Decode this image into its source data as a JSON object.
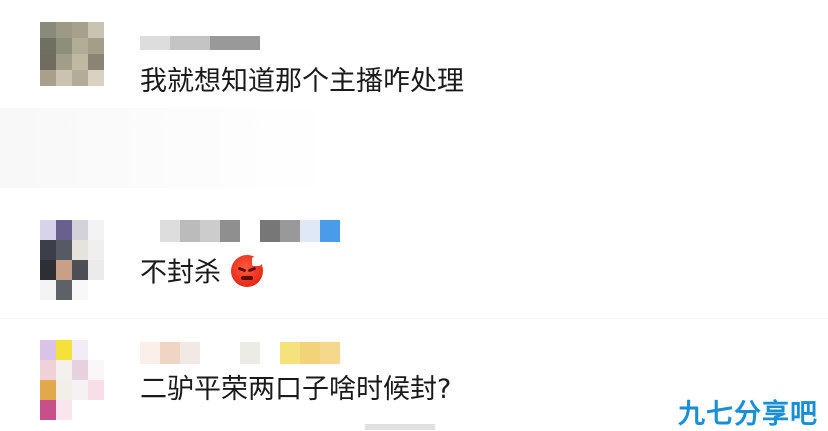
{
  "comments": [
    {
      "text": "我就想知道那个主播咋处理"
    },
    {
      "text": "不封杀",
      "emoji": "angry-face-emoji"
    },
    {
      "text": "二驴平荣两口子啥时候封?"
    }
  ],
  "watermark": "九七分享吧",
  "colors": {
    "text": "#1a1a1a",
    "watermark": "#1a8fd6",
    "emoji": "#e8291b"
  }
}
